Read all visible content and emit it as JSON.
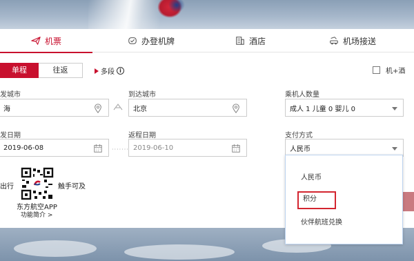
{
  "tabs": [
    {
      "label": "机票",
      "icon": "plane-icon",
      "active": true
    },
    {
      "label": "办登机牌",
      "icon": "checkin-icon",
      "active": false
    },
    {
      "label": "酒店",
      "icon": "hotel-icon",
      "active": false
    },
    {
      "label": "机场接送",
      "icon": "car-icon",
      "active": false
    }
  ],
  "trip": {
    "oneway": "单程",
    "round": "往返",
    "multi": "多段"
  },
  "hotel_combo": "机+酒",
  "labels": {
    "from": "发城市",
    "to": "到达城市",
    "pax": "乘机人数量",
    "depart": "发日期",
    "return": "返程日期",
    "pay": "支付方式"
  },
  "values": {
    "from": "海",
    "to": "北京",
    "pax": "成人 1  儿童 0  婴儿 0",
    "depart": "2019-06-08",
    "return": "2019-06-10",
    "pay": "人民币"
  },
  "pay_options": [
    "人民币",
    "积分",
    "伙伴航班兑换"
  ],
  "app": {
    "left_text": "出行",
    "right_text": "触手可及",
    "name": "东方航空APP",
    "link": "功能简介 >"
  },
  "colors": {
    "accent": "#c8102e",
    "highlight": "#d3242f",
    "dropdown_border": "#bcd3ef"
  }
}
